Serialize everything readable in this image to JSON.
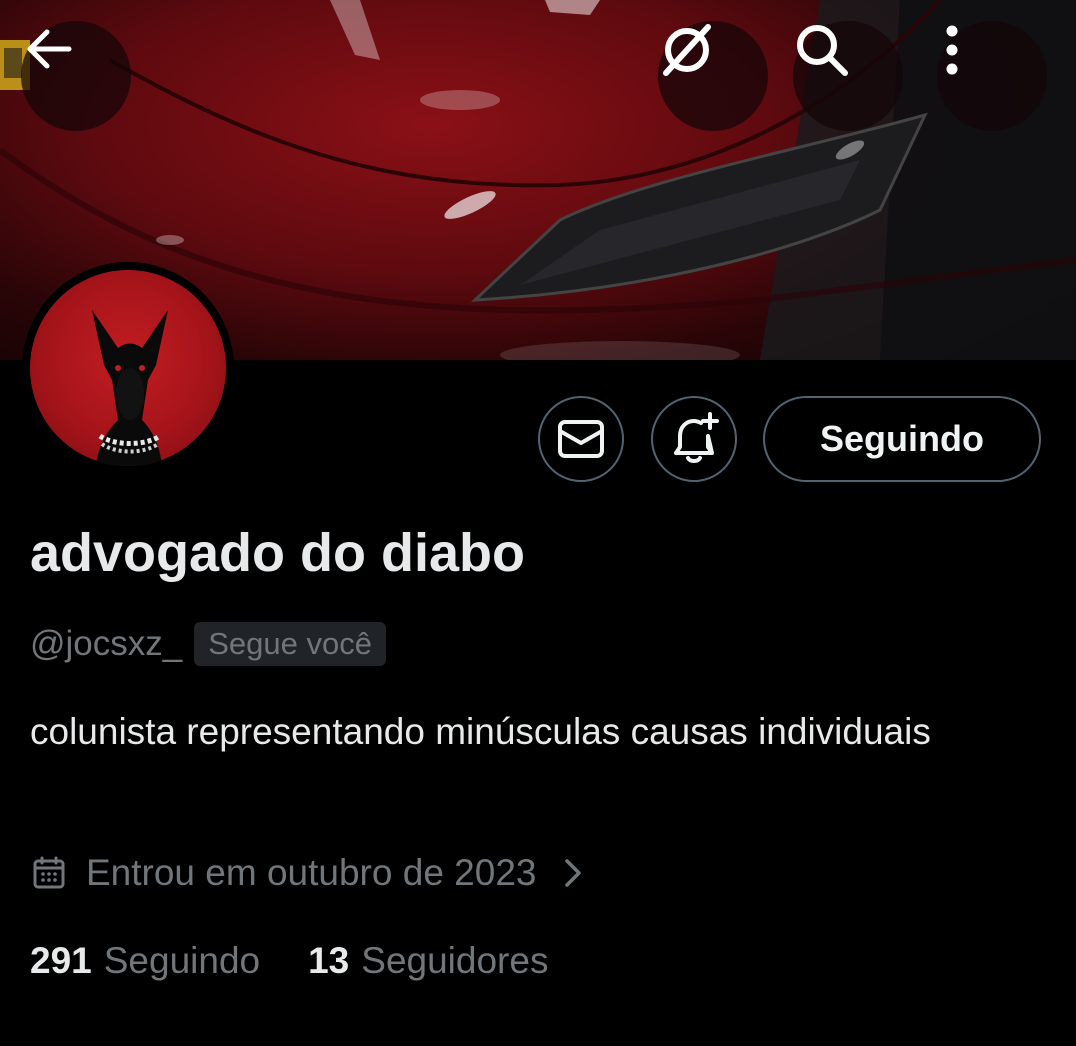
{
  "profile": {
    "display_name": "advogado do diabo",
    "handle": "@jocsxz_",
    "follows_you_badge": "Segue você",
    "bio": "colunista representando minúsculas causas individuais",
    "joined": "Entrou em outubro de 2023",
    "following_count": "291",
    "following_label": "Seguindo",
    "followers_count": "13",
    "followers_label": "Seguidores"
  },
  "actions": {
    "follow_button_label": "Seguindo",
    "message_icon": "envelope-icon",
    "notify_icon": "bell-plus-icon"
  },
  "header": {
    "back_icon": "arrow-left-icon",
    "grok_icon": "grok-icon",
    "search_icon": "search-icon",
    "more_icon": "more-vertical-icon"
  },
  "colors": {
    "background": "#000000",
    "primary_text": "#e7e9ea",
    "secondary_text": "#71767b",
    "border": "#536471",
    "banner_red": "#8a1016",
    "avatar_red": "#b5171d"
  }
}
